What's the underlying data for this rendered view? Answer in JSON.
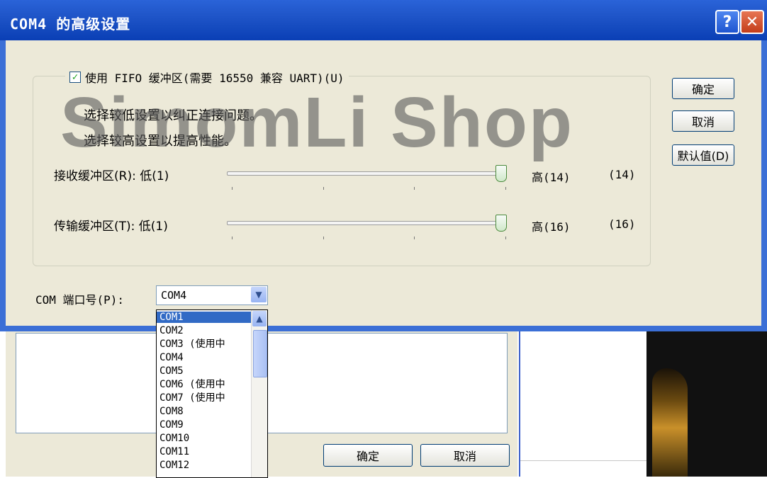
{
  "dialog": {
    "title": "COM4 的高级设置",
    "help_glyph": "?",
    "close_glyph": "✕"
  },
  "fifo": {
    "label": "使用 FIFO 缓冲区(需要 16550 兼容 UART)(U)",
    "checked": true
  },
  "hints": {
    "low": "选择较低设置以纠正连接问题。",
    "high": "选择较高设置以提高性能。"
  },
  "receive": {
    "label": "接收缓冲区(R): 低(1)",
    "max_label": "高(14)",
    "value_label": "(14)",
    "value": 14,
    "min": 1,
    "max": 14
  },
  "transmit": {
    "label": "传输缓冲区(T): 低(1)",
    "max_label": "高(16)",
    "value_label": "(16)",
    "value": 16,
    "min": 1,
    "max": 16
  },
  "buttons": {
    "ok": "确定",
    "cancel": "取消",
    "defaults": "默认值(D)"
  },
  "com_port": {
    "label": "COM 端口号(P):",
    "selected": "COM4",
    "options": [
      {
        "text": "COM1",
        "selected": true
      },
      {
        "text": "COM2"
      },
      {
        "text": "COM3 (使用中"
      },
      {
        "text": "COM4"
      },
      {
        "text": "COM5"
      },
      {
        "text": "COM6 (使用中"
      },
      {
        "text": "COM7 (使用中"
      },
      {
        "text": "COM8"
      },
      {
        "text": "COM9"
      },
      {
        "text": "COM10"
      },
      {
        "text": "COM11"
      },
      {
        "text": "COM12"
      }
    ]
  },
  "background_window": {
    "ok": "确定",
    "cancel": "取消"
  },
  "watermark": "SimomLi Shop",
  "icons": {
    "check": "checkmark-icon",
    "combo_arrow": "chevron-down-icon",
    "scroll_up": "chevron-up-icon"
  }
}
